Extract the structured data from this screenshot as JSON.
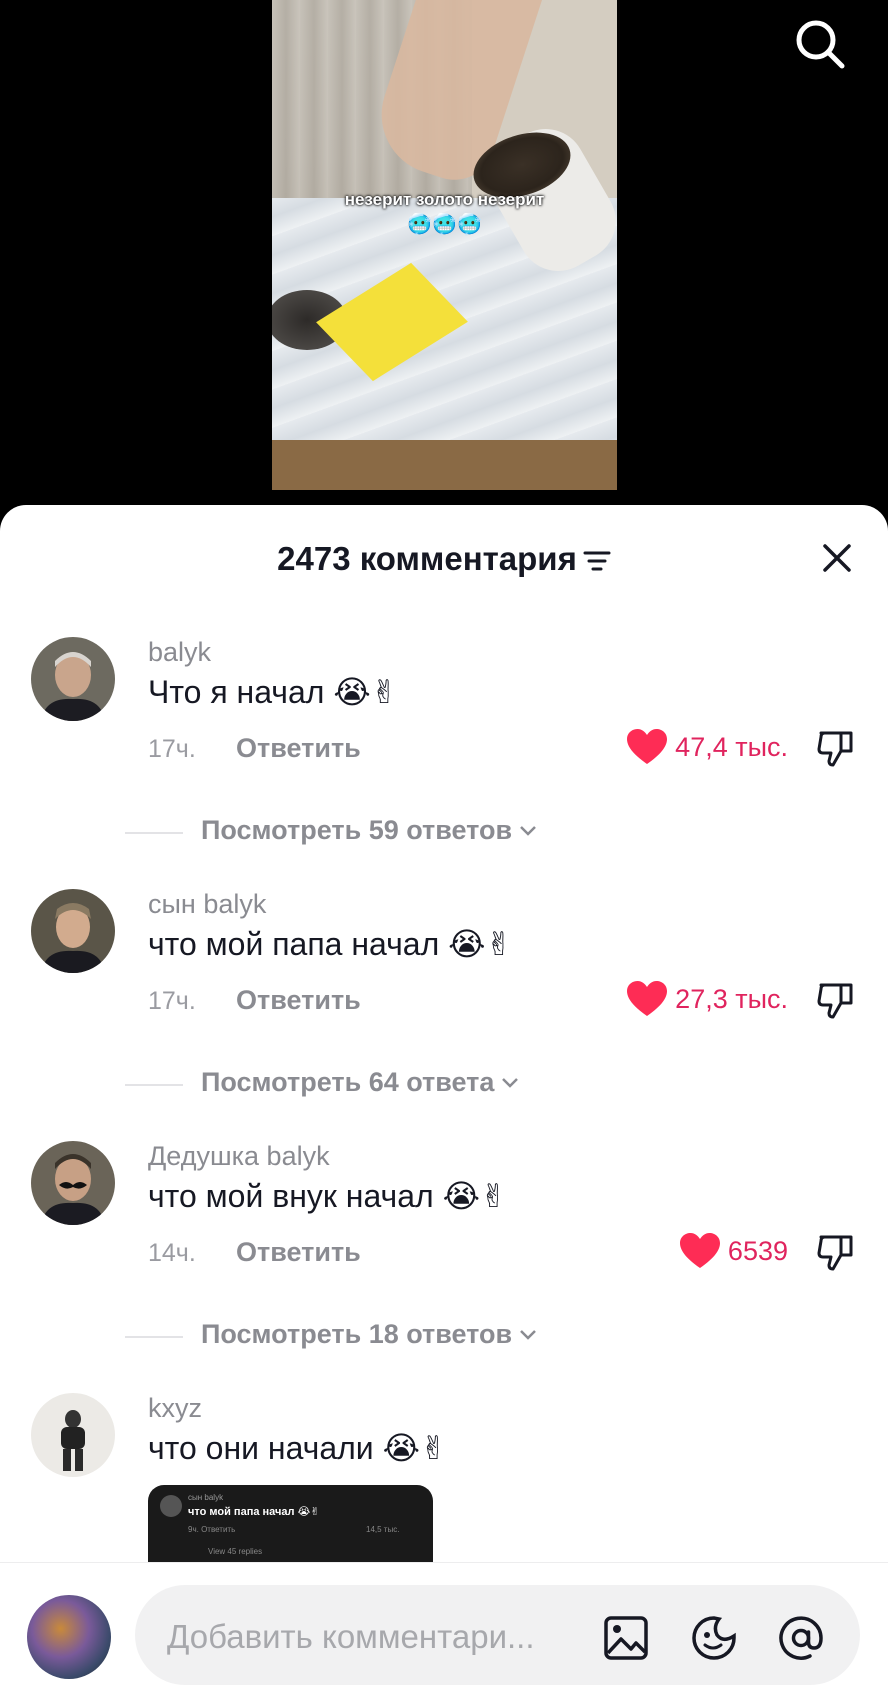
{
  "video": {
    "caption": "незерит золото незерит",
    "caption_emoji": "🥶🥶🥶"
  },
  "header": {
    "title": "2473 комментария"
  },
  "comments": [
    {
      "username": "balyk",
      "text": "Что я начал 😭✌",
      "time": "17ч.",
      "reply_label": "Ответить",
      "likes": "47,4 тыс.",
      "replies_label": "Посмотреть 59 ответов"
    },
    {
      "username": "сын balyk",
      "text": "что мой папа начал 😭✌",
      "time": "17ч.",
      "reply_label": "Ответить",
      "likes": "27,3 тыс.",
      "replies_label": "Посмотреть 64 ответа"
    },
    {
      "username": "Дедушка balyk",
      "text": "что мой внук начал 😭✌",
      "time": "14ч.",
      "reply_label": "Ответить",
      "likes": "6539",
      "replies_label": "Посмотреть 18 ответов"
    },
    {
      "username": "kxyz",
      "text": "что они начали 😭✌"
    }
  ],
  "attachment": {
    "user": "сын balyk",
    "text": "что мой папа начал 😭✌",
    "meta": "9ч.    Ответить",
    "count": "14,5 тыс.",
    "view": "View 45 replies"
  },
  "composer": {
    "placeholder": "Добавить комментари..."
  },
  "colors": {
    "like": "#fe2c55",
    "text_primary": "#161823",
    "text_secondary": "#8a8b91"
  }
}
